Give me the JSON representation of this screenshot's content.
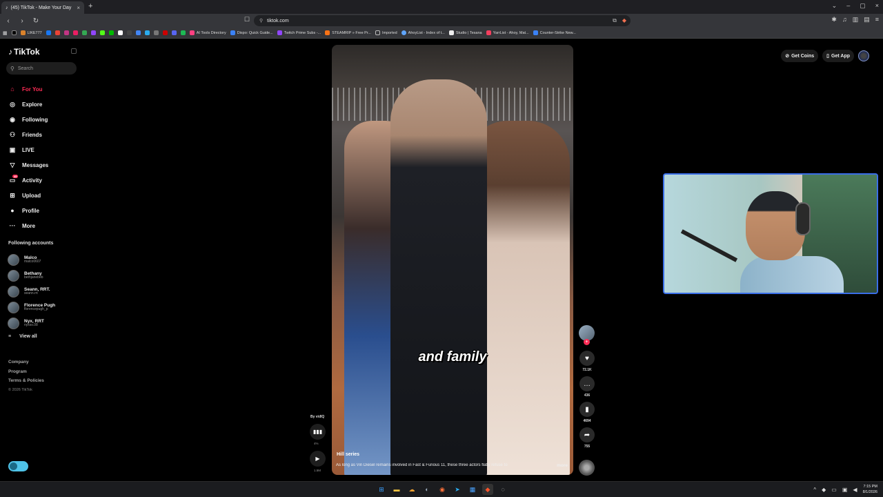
{
  "browser": {
    "tab_title": "(45) TikTok - Make Your Day",
    "url": "tiktok.com",
    "bookmarks": [
      "LIKE777",
      "AI Tools Directory",
      "Dispo: Quick Guide...",
      "Twitch Prime Subs -...",
      "STEAMRIP » Free Pr...",
      "Imported",
      "AhoyList - Index of t...",
      "Studio | Tesana",
      "YarrList - Ahoy, Mat...",
      "Counter-Strike New..."
    ]
  },
  "tiktok": {
    "logo": "TikTok",
    "search_placeholder": "Search",
    "nav": [
      {
        "label": "For You",
        "icon": "home-icon"
      },
      {
        "label": "Explore",
        "icon": "compass-icon"
      },
      {
        "label": "Following",
        "icon": "following-icon"
      },
      {
        "label": "Friends",
        "icon": "friends-icon"
      },
      {
        "label": "LIVE",
        "icon": "live-icon"
      },
      {
        "label": "Messages",
        "icon": "messages-icon"
      },
      {
        "label": "Activity",
        "icon": "activity-icon",
        "badge": "45"
      },
      {
        "label": "Upload",
        "icon": "upload-icon"
      },
      {
        "label": "Profile",
        "icon": "profile-icon"
      },
      {
        "label": "More",
        "icon": "more-icon"
      }
    ],
    "following_title": "Following accounts",
    "accounts": [
      {
        "name": "Malco",
        "handle": "malco0607"
      },
      {
        "name": "Bethany",
        "handle": "bethjanebeb"
      },
      {
        "name": "Seann, RRT.",
        "handle": "seann.rrt"
      },
      {
        "name": "Florence Pugh",
        "handle": "florencepugh_p"
      },
      {
        "name": "Nyx, RRT",
        "handle": "nyxss.08"
      }
    ],
    "view_all": "View all",
    "footer": [
      "Company",
      "Program",
      "Terms & Policies"
    ],
    "copyright": "© 2026 TikTok",
    "get_coins": "Get Coins",
    "get_app": "Get App",
    "video": {
      "caption_overlay": "and family",
      "title": "Hill series",
      "description": "As long as Vin Diesel remains involved in Fast & Furious 11, these three actors flatly refuse to",
      "more": "more",
      "by": "By vidIQ",
      "progress_text": "4%",
      "views_text": "1.5M"
    },
    "actions": {
      "likes": "72.1K",
      "comments": "436",
      "saves": "4694",
      "shares": "755"
    }
  },
  "taskbar": {
    "time": "7:15 PM",
    "date": "8/1/2026"
  },
  "colors": {
    "accent": "#fe2c55",
    "webcam_border": "#3a6ee8"
  }
}
